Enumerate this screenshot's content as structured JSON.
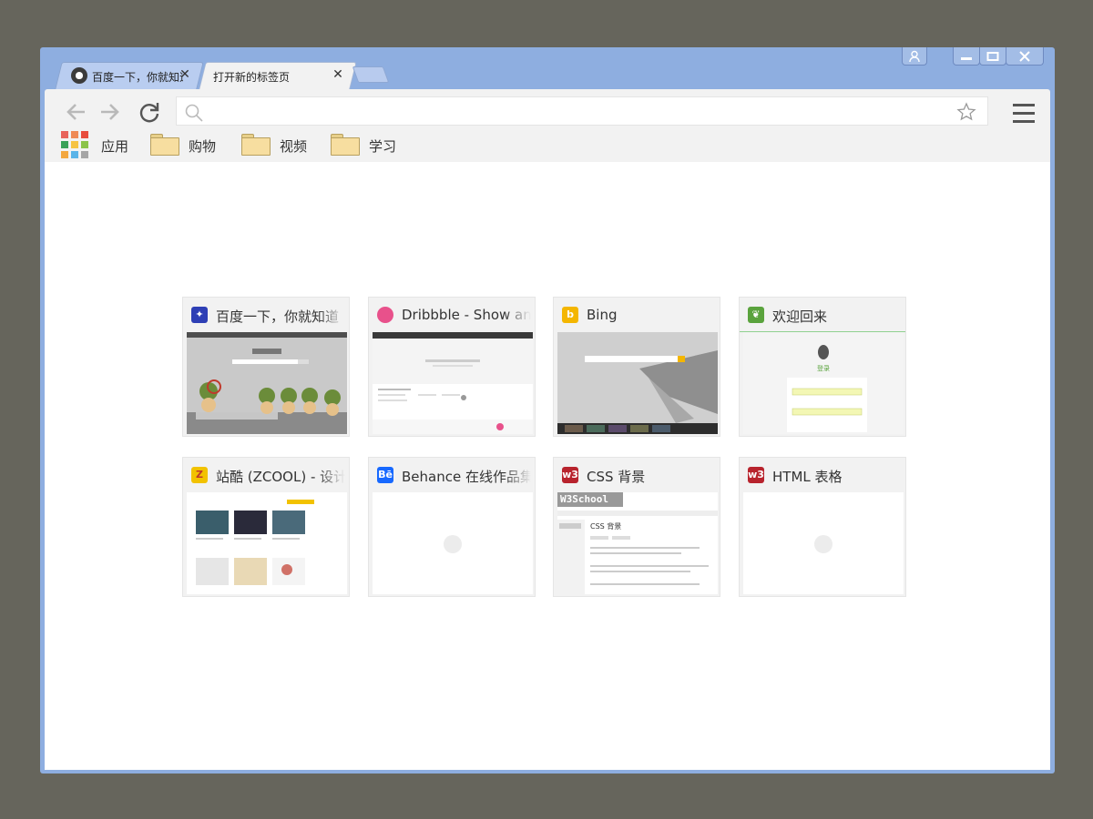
{
  "tabs": [
    {
      "title": "百度一下，你就知道",
      "active": false,
      "favicon": "baidu-paw-icon"
    },
    {
      "title": "打开新的标签页",
      "active": true
    }
  ],
  "toolbar": {
    "omnibox_placeholder": "",
    "omnibox_value": ""
  },
  "bookmarks": {
    "apps_label": "应用",
    "items": [
      "购物",
      "视频",
      "学习"
    ]
  },
  "tiles": [
    {
      "title": "百度一下，你就知道",
      "icon": "baidu-paw-icon",
      "icon_color": "#2e3fb5"
    },
    {
      "title": "Dribbble - Show and tell for designers",
      "icon": "dribbble-icon",
      "icon_color": "#e8518b"
    },
    {
      "title": "Bing",
      "icon": "bing-icon",
      "icon_color": "#f4b600"
    },
    {
      "title": "欢迎回来",
      "icon": "evernote-icon",
      "icon_color": "#5aa33d"
    },
    {
      "title": "站酷 (ZCOOL) - 设计师互动平台",
      "icon": "zcool-icon",
      "icon_color": "#f2c200"
    },
    {
      "title": "Behance 在线作品集",
      "icon": "behance-icon",
      "icon_color": "#1769ff",
      "icon_text": "Bē"
    },
    {
      "title": "CSS 背景",
      "icon": "w3school-icon",
      "icon_color": "#b8232d",
      "icon_text": "w3"
    },
    {
      "title": "HTML 表格",
      "icon": "w3school-icon",
      "icon_color": "#b8232d",
      "icon_text": "w3"
    }
  ],
  "thumbnails": {
    "w3school_logo": "W3School",
    "css_heading": "CSS 背景",
    "evernote_login": "登录"
  },
  "colors": {
    "frame": "#8eaee0",
    "desktop": "#66655c",
    "toolbar": "#f2f2f2"
  }
}
